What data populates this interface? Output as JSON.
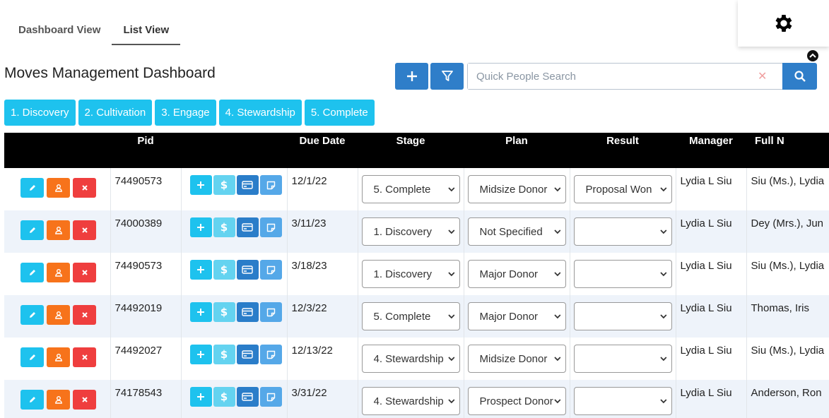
{
  "tabs": [
    {
      "label": "Dashboard View",
      "active": false
    },
    {
      "label": "List View",
      "active": true
    }
  ],
  "page_title": "Moves Management Dashboard",
  "search": {
    "placeholder": "Quick People Search",
    "value": ""
  },
  "stage_filters": [
    "1. Discovery",
    "2. Cultivation",
    "3. Engage",
    "4. Stewardship",
    "5. Complete"
  ],
  "columns": [
    "",
    "Pid",
    "",
    "Due Date",
    "Stage",
    "Plan",
    "Result",
    "Manager",
    "Full N"
  ],
  "rows": [
    {
      "pid": "74490573",
      "due": "12/1/22",
      "stage": "5. Complete",
      "plan": "Midsize Donor",
      "result": "Proposal Won",
      "manager": "Lydia L Siu",
      "name": "Siu (Ms.), Lydia"
    },
    {
      "pid": "74000389",
      "due": "3/11/23",
      "stage": "1. Discovery",
      "plan": "Not Specified",
      "result": "",
      "manager": "Lydia L Siu",
      "name": "Dey (Mrs.), Jun"
    },
    {
      "pid": "74490573",
      "due": "3/18/23",
      "stage": "1. Discovery",
      "plan": "Major Donor",
      "result": "",
      "manager": "Lydia L Siu",
      "name": "Siu (Ms.), Lydia"
    },
    {
      "pid": "74492019",
      "due": "12/3/22",
      "stage": "5. Complete",
      "plan": "Major Donor",
      "result": "",
      "manager": "Lydia L Siu",
      "name": "Thomas, Iris"
    },
    {
      "pid": "74492027",
      "due": "12/13/22",
      "stage": "4. Stewardship",
      "plan": "Midsize Donor",
      "result": "",
      "manager": "Lydia L Siu",
      "name": "Siu (Ms.), Lydia"
    },
    {
      "pid": "74178543",
      "due": "3/31/22",
      "stage": "4. Stewardship",
      "plan": "Prospect Donor",
      "result": "",
      "manager": "Lydia L Siu",
      "name": "Anderson, Ron"
    }
  ],
  "colors": {
    "accent": "#2f7ec9",
    "cyan": "#1ec2ee",
    "orange": "#f7731b",
    "red": "#ef3e3e",
    "header_bg": "#000000",
    "row_alt": "#eef3fa"
  },
  "icons": {
    "settings": "gear-icon",
    "collapse": "chevron-up-icon",
    "add": "plus-icon",
    "filter": "filter-icon",
    "search": "search-icon",
    "clear": "close-icon"
  }
}
